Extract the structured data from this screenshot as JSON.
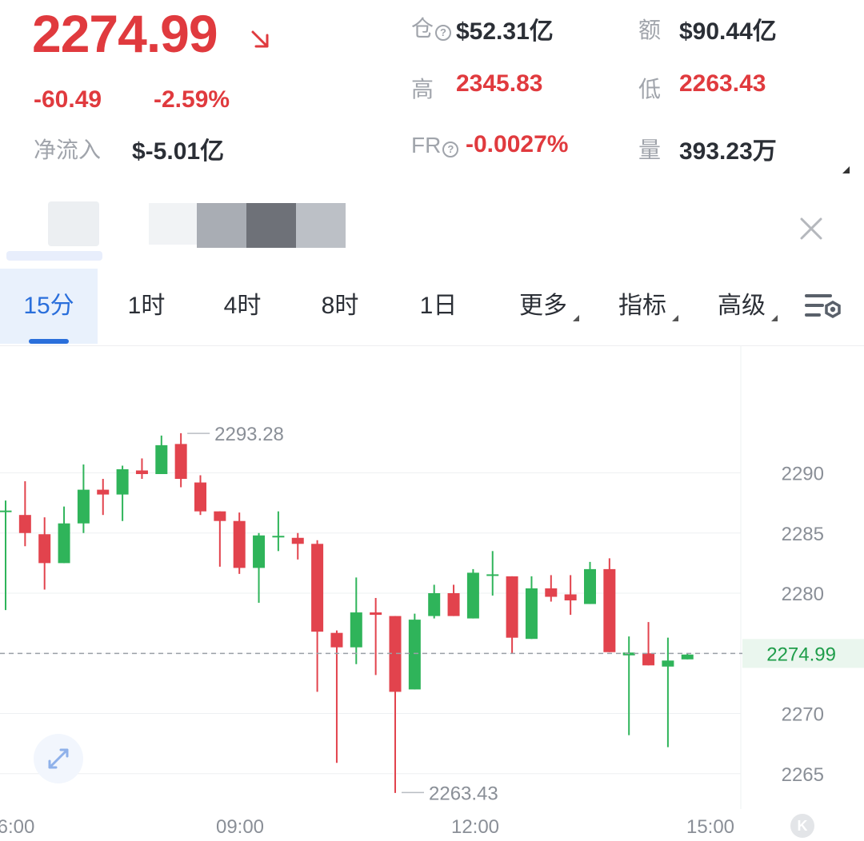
{
  "ticker": {
    "last_price": "2274.99",
    "change": "-60.49",
    "change_pct": "-2.59%",
    "net_inflow_label": "净流入",
    "net_inflow_value": "$-5.01亿"
  },
  "stats": {
    "open_interest_label": "仓",
    "open_interest_value": "$52.31亿",
    "turnover_label": "额",
    "turnover_value": "$90.44亿",
    "high_label": "高",
    "high_value": "2345.83",
    "low_label": "低",
    "low_value": "2263.43",
    "funding_label": "FR",
    "funding_value": "-0.0027%",
    "volume_label": "量",
    "volume_value": "393.23万"
  },
  "tabs": [
    {
      "label": "15分",
      "active": true
    },
    {
      "label": "1时",
      "active": false
    },
    {
      "label": "4时",
      "active": false
    },
    {
      "label": "8时",
      "active": false
    },
    {
      "label": "1日",
      "active": false
    },
    {
      "label": "更多",
      "active": false
    },
    {
      "label": "指标",
      "active": false
    },
    {
      "label": "高级",
      "active": false
    }
  ],
  "colors": {
    "up": "#2fb45a",
    "down": "#e2434d",
    "accent": "#2a6fdb"
  },
  "chart_data": {
    "type": "candlestick",
    "interval": "15分",
    "ylim": [
      2263,
      2298
    ],
    "y_ticks": [
      2290,
      2285,
      2280,
      2270,
      2265
    ],
    "x_ticks": [
      "6:00",
      "09:00",
      "12:00",
      "15:00"
    ],
    "last_price_label": "2274.99",
    "last_price": 2274.99,
    "max_annotation": {
      "value": 2293.28,
      "label": "2293.28"
    },
    "min_annotation": {
      "value": 2263.43,
      "label": "2263.43"
    },
    "candles": [
      {
        "o": 2286.8,
        "c": 2286.8,
        "h": 2287.7,
        "l": 2278.6
      },
      {
        "o": 2286.5,
        "c": 2285.0,
        "h": 2289.3,
        "l": 2283.9
      },
      {
        "o": 2284.9,
        "c": 2282.5,
        "h": 2286.3,
        "l": 2280.3
      },
      {
        "o": 2282.5,
        "c": 2285.8,
        "h": 2287.2,
        "l": 2282.5
      },
      {
        "o": 2285.8,
        "c": 2288.6,
        "h": 2290.7,
        "l": 2285.0
      },
      {
        "o": 2288.6,
        "c": 2288.2,
        "h": 2289.5,
        "l": 2286.5
      },
      {
        "o": 2288.2,
        "c": 2290.3,
        "h": 2290.6,
        "l": 2286.0
      },
      {
        "o": 2290.2,
        "c": 2289.9,
        "h": 2291.2,
        "l": 2289.5
      },
      {
        "o": 2289.9,
        "c": 2292.3,
        "h": 2293.1,
        "l": 2289.9
      },
      {
        "o": 2292.4,
        "c": 2289.5,
        "h": 2293.3,
        "l": 2288.8
      },
      {
        "o": 2289.2,
        "c": 2286.8,
        "h": 2289.8,
        "l": 2286.5
      },
      {
        "o": 2286.8,
        "c": 2286.0,
        "h": 2286.8,
        "l": 2282.2
      },
      {
        "o": 2286.0,
        "c": 2282.1,
        "h": 2286.7,
        "l": 2281.6
      },
      {
        "o": 2282.1,
        "c": 2284.8,
        "h": 2285.0,
        "l": 2279.2
      },
      {
        "o": 2284.7,
        "c": 2284.7,
        "h": 2286.8,
        "l": 2283.5
      },
      {
        "o": 2284.6,
        "c": 2284.1,
        "h": 2285.0,
        "l": 2282.8
      },
      {
        "o": 2284.1,
        "c": 2276.8,
        "h": 2284.4,
        "l": 2271.8
      },
      {
        "o": 2276.7,
        "c": 2275.5,
        "h": 2276.9,
        "l": 2265.9
      },
      {
        "o": 2275.5,
        "c": 2278.4,
        "h": 2281.3,
        "l": 2274.1
      },
      {
        "o": 2278.4,
        "c": 2278.2,
        "h": 2279.6,
        "l": 2273.2
      },
      {
        "o": 2278.1,
        "c": 2271.8,
        "h": 2278.1,
        "l": 2263.4
      },
      {
        "o": 2272.0,
        "c": 2277.8,
        "h": 2278.3,
        "l": 2272.0
      },
      {
        "o": 2278.1,
        "c": 2280.0,
        "h": 2280.7,
        "l": 2277.9
      },
      {
        "o": 2280.0,
        "c": 2278.1,
        "h": 2280.7,
        "l": 2278.1
      },
      {
        "o": 2277.9,
        "c": 2281.7,
        "h": 2282.0,
        "l": 2277.9
      },
      {
        "o": 2281.5,
        "c": 2281.5,
        "h": 2283.5,
        "l": 2279.8
      },
      {
        "o": 2281.4,
        "c": 2276.3,
        "h": 2281.4,
        "l": 2275.0
      },
      {
        "o": 2276.2,
        "c": 2280.4,
        "h": 2281.4,
        "l": 2276.2
      },
      {
        "o": 2280.4,
        "c": 2279.7,
        "h": 2281.5,
        "l": 2279.3
      },
      {
        "o": 2279.9,
        "c": 2279.4,
        "h": 2281.5,
        "l": 2278.2
      },
      {
        "o": 2279.1,
        "c": 2282.0,
        "h": 2282.6,
        "l": 2279.1
      },
      {
        "o": 2282.0,
        "c": 2275.1,
        "h": 2282.9,
        "l": 2275.1
      },
      {
        "o": 2274.9,
        "c": 2275.0,
        "h": 2276.4,
        "l": 2268.2
      },
      {
        "o": 2275.0,
        "c": 2274.0,
        "h": 2277.6,
        "l": 2274.0
      },
      {
        "o": 2273.9,
        "c": 2274.4,
        "h": 2276.3,
        "l": 2267.2
      },
      {
        "o": 2274.5,
        "c": 2274.9,
        "h": 2275.0,
        "l": 2274.5
      }
    ]
  }
}
